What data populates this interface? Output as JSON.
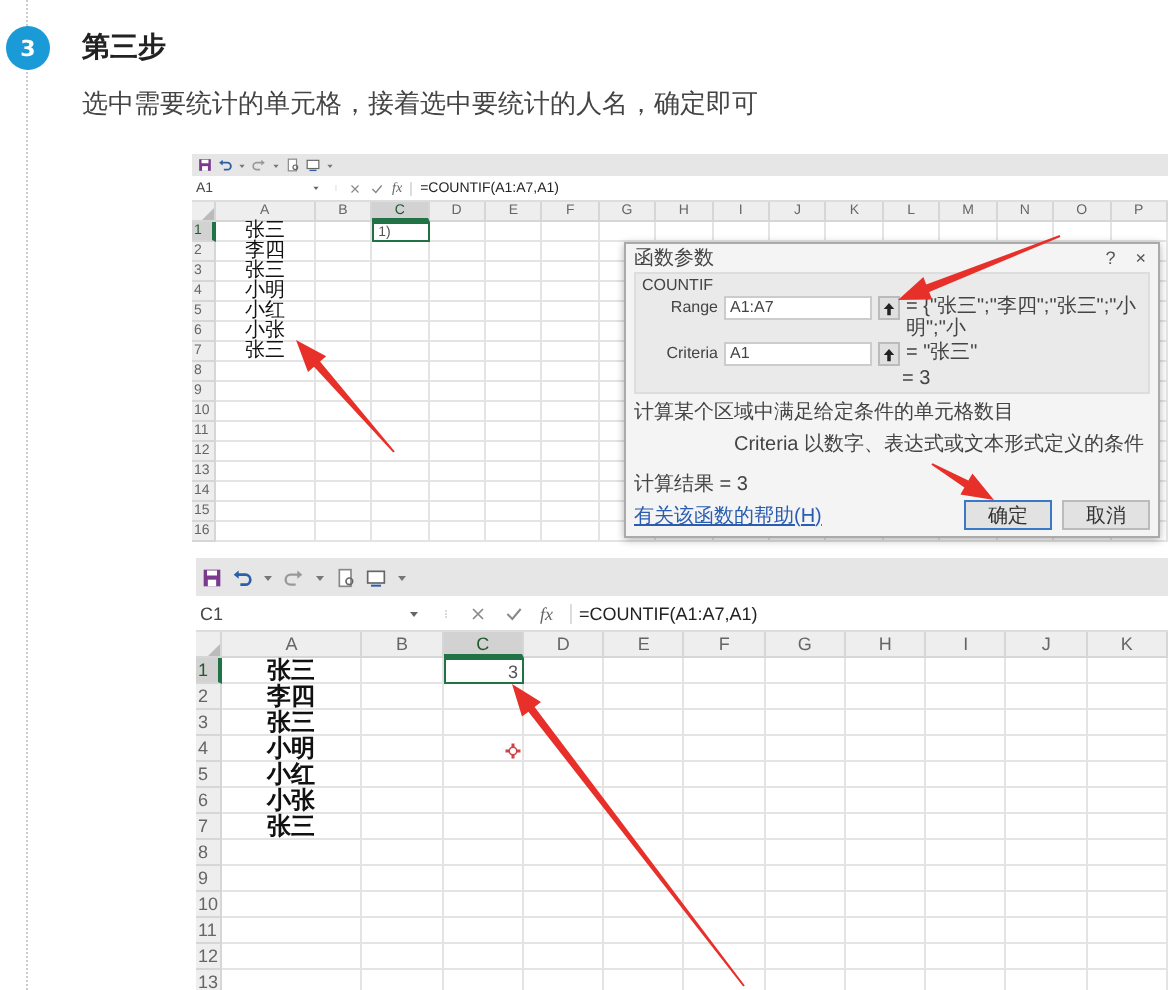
{
  "step": {
    "number": "3",
    "title": "第三步",
    "description": "选中需要统计的单元格，接着选中要统计的人名，确定即可"
  },
  "screenshots": [
    {
      "name_box": "A1",
      "fx": "fx",
      "formula": "=COUNTIF(A1:A7,A1)",
      "active_value": "1)",
      "columns": [
        {
          "label": "A",
          "selected": false
        },
        {
          "label": "B",
          "selected": false
        },
        {
          "label": "C",
          "selected": true
        },
        {
          "label": "D",
          "selected": false
        },
        {
          "label": "E",
          "selected": false
        },
        {
          "label": "F",
          "selected": false
        },
        {
          "label": "G",
          "selected": false
        },
        {
          "label": "H",
          "selected": false
        },
        {
          "label": "I",
          "selected": false
        },
        {
          "label": "J",
          "selected": false
        },
        {
          "label": "K",
          "selected": false
        },
        {
          "label": "L",
          "selected": false
        },
        {
          "label": "M",
          "selected": false
        },
        {
          "label": "N",
          "selected": false
        },
        {
          "label": "O",
          "selected": false
        },
        {
          "label": "P",
          "selected": false
        }
      ],
      "rows": [
        {
          "number": "1",
          "name": "张三",
          "selected": true
        },
        {
          "number": "2",
          "name": "李四",
          "selected": false
        },
        {
          "number": "3",
          "name": "张三",
          "selected": false
        },
        {
          "number": "4",
          "name": "小明",
          "selected": false
        },
        {
          "number": "5",
          "name": "小红",
          "selected": false
        },
        {
          "number": "6",
          "name": "小张",
          "selected": false
        },
        {
          "number": "7",
          "name": "张三",
          "selected": false
        },
        {
          "number": "8",
          "selected": false
        },
        {
          "number": "9",
          "selected": false
        },
        {
          "number": "10",
          "selected": false
        },
        {
          "number": "11",
          "selected": false
        },
        {
          "number": "12",
          "selected": false
        },
        {
          "number": "13",
          "selected": false
        },
        {
          "number": "14",
          "selected": false
        },
        {
          "number": "15",
          "selected": false
        },
        {
          "number": "16",
          "selected": false
        }
      ],
      "dialog": {
        "title": "函数参数",
        "help": "?",
        "close": "×",
        "function": "COUNTIF",
        "args": [
          {
            "label": "Range",
            "value": "A1:A7",
            "result": "= {\"张三\";\"李四\";\"张三\";\"小明\";\"小"
          },
          {
            "label": "Criteria",
            "value": "A1",
            "result": "= \"张三\""
          }
        ],
        "total": "= 3",
        "description": "计算某个区域中满足给定条件的单元格数目",
        "arg_help": "Criteria  以数字、表达式或文本形式定义的条件",
        "result_line": "计算结果 = 3",
        "help_link": "有关该函数的帮助(H)",
        "buttons": [
          "确定",
          "取消"
        ]
      }
    },
    {
      "name_box": "C1",
      "fx": "fx",
      "formula": "=COUNTIF(A1:A7,A1)",
      "active_value": "3",
      "columns": [
        {
          "label": "A",
          "selected": false
        },
        {
          "label": "B",
          "selected": false
        },
        {
          "label": "C",
          "selected": true
        },
        {
          "label": "D",
          "selected": false
        },
        {
          "label": "E",
          "selected": false
        },
        {
          "label": "F",
          "selected": false
        },
        {
          "label": "G",
          "selected": false
        },
        {
          "label": "H",
          "selected": false
        },
        {
          "label": "I",
          "selected": false
        },
        {
          "label": "J",
          "selected": false
        },
        {
          "label": "K",
          "selected": false
        }
      ],
      "rows": [
        {
          "number": "1",
          "name": "张三",
          "selected": true
        },
        {
          "number": "2",
          "name": "李四",
          "selected": false
        },
        {
          "number": "3",
          "name": "张三",
          "selected": false
        },
        {
          "number": "4",
          "name": "小明",
          "selected": false
        },
        {
          "number": "5",
          "name": "小红",
          "selected": false
        },
        {
          "number": "6",
          "name": "小张",
          "selected": false
        },
        {
          "number": "7",
          "name": "张三",
          "selected": false
        },
        {
          "number": "8",
          "selected": false
        },
        {
          "number": "9",
          "selected": false
        },
        {
          "number": "10",
          "selected": false
        },
        {
          "number": "11",
          "selected": false
        },
        {
          "number": "12",
          "selected": false
        },
        {
          "number": "13",
          "selected": false
        }
      ]
    }
  ]
}
